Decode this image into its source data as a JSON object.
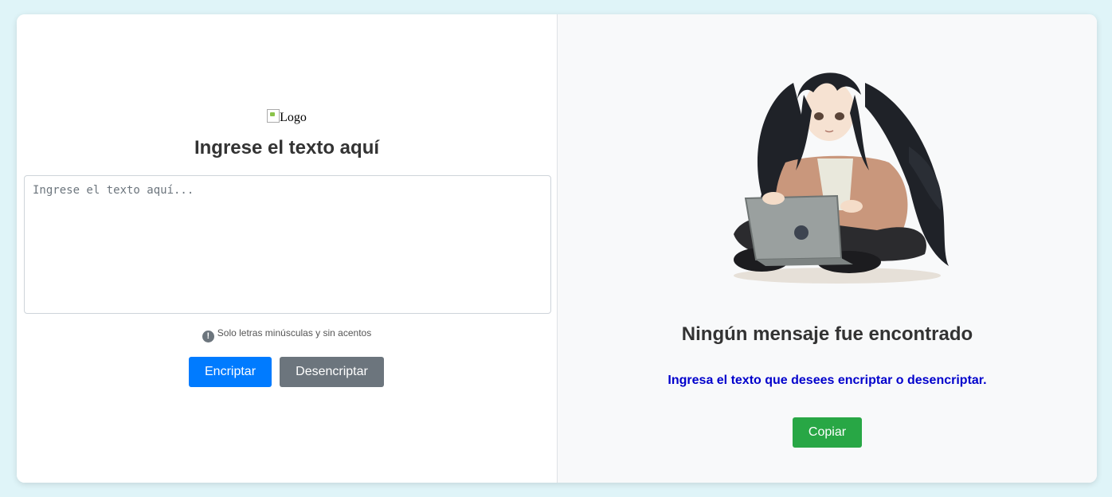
{
  "left": {
    "logo_alt": "Logo",
    "title": "Ingrese el texto aquí",
    "textarea": {
      "value": "",
      "placeholder": "Ingrese el texto aquí..."
    },
    "hint": "Solo letras minúsculas y sin acentos",
    "hint_icon": "!",
    "encrypt_label": "Encriptar",
    "decrypt_label": "Desencriptar"
  },
  "right": {
    "illustration": "anime-girl-laptop-illustration",
    "title": "Ningún mensaje fue encontrado",
    "message": "Ingresa el texto que desees encriptar o desencriptar.",
    "copy_label": "Copiar"
  },
  "colors": {
    "primary": "#007bff",
    "secondary": "#6c757d",
    "success": "#28a745",
    "message": "#0000cc",
    "background": "#dff4f8"
  }
}
